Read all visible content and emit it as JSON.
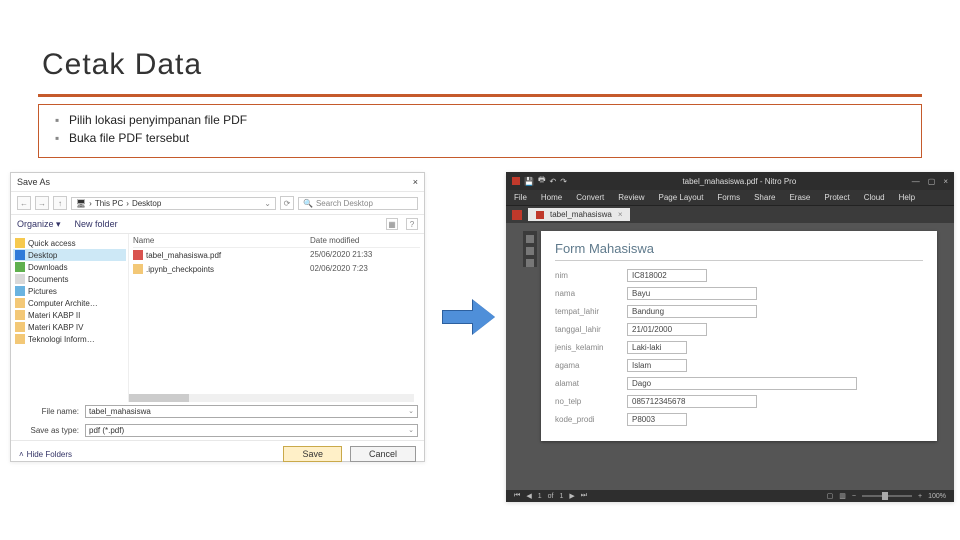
{
  "slide": {
    "title": "Cetak Data",
    "bullets": [
      "Pilih lokasi penyimpanan file PDF",
      "Buka file PDF tersebut"
    ]
  },
  "saveas": {
    "window_title": "Save As",
    "close": "×",
    "path_segments": [
      "This PC",
      "Desktop"
    ],
    "search_placeholder": "Search Desktop",
    "organize": "Organize ▾",
    "new_folder": "New folder",
    "tree": {
      "quick": "Quick access",
      "desktop": "Desktop",
      "downloads": "Downloads",
      "documents": "Documents",
      "pictures": "Pictures",
      "f1": "Computer Archite…",
      "f2": "Materi KABP II",
      "f3": "Materi KABP IV",
      "f4": "Teknologi Inform…"
    },
    "columns": {
      "name": "Name",
      "date": "Date modified"
    },
    "files": [
      {
        "name": "tabel_mahasiswa.pdf",
        "date": "25/06/2020 21:33",
        "kind": "pdf"
      },
      {
        "name": ".ipynb_checkpoints",
        "date": "02/06/2020 7:23",
        "kind": "folder"
      }
    ],
    "filename_label": "File name:",
    "filename_value": "tabel_mahasiswa",
    "savetype_label": "Save as type:",
    "savetype_value": "pdf (*.pdf)",
    "hide_folders": "Hide Folders",
    "save": "Save",
    "cancel": "Cancel"
  },
  "pdf": {
    "window_title": "tabel_mahasiswa.pdf - Nitro Pro",
    "menus": [
      "File",
      "Home",
      "Convert",
      "Review",
      "Page Layout",
      "Forms",
      "Share",
      "Erase",
      "Protect",
      "Cloud",
      "Help"
    ],
    "tab_label": "tabel_mahasiswa",
    "form_title": "Form Mahasiswa",
    "fields": {
      "nim": {
        "label": "nim",
        "value": "IC818002"
      },
      "nama": {
        "label": "nama",
        "value": "Bayu"
      },
      "tempat_lahir": {
        "label": "tempat_lahir",
        "value": "Bandung"
      },
      "tanggal_lahir": {
        "label": "tanggal_lahir",
        "value": "21/01/2000"
      },
      "jenis_kelamin": {
        "label": "jenis_kelamin",
        "value": "Laki-laki"
      },
      "agama": {
        "label": "agama",
        "value": "Islam"
      },
      "alamat": {
        "label": "alamat",
        "value": "Dago"
      },
      "no_telp": {
        "label": "no_telp",
        "value": "085712345678"
      },
      "kode_prodi": {
        "label": "kode_prodi",
        "value": "P8003"
      }
    },
    "status": {
      "page_of": "of",
      "page_current": "1",
      "page_total": "1",
      "zoom": "100%"
    }
  }
}
